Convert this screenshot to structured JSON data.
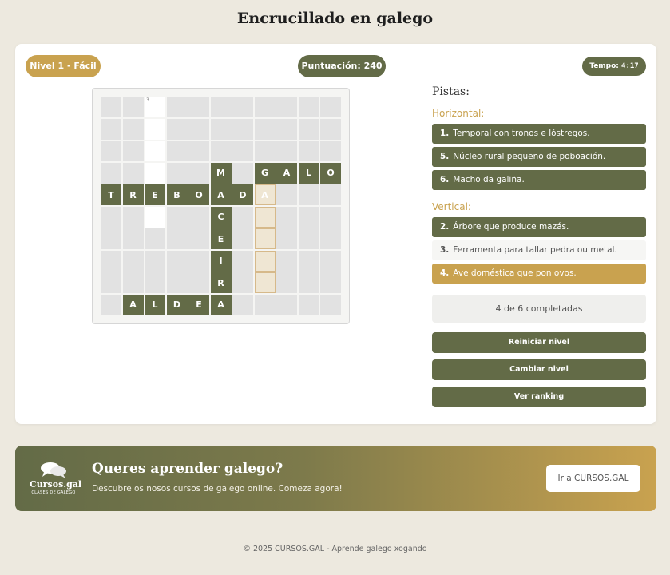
{
  "page": {
    "title": "Encrucillado en galego"
  },
  "header": {
    "level": "Nivel 1 - Fácil",
    "score": "Puntuación: 240",
    "timer_label": "Tempo:",
    "timer_value": "4:17"
  },
  "crossword": {
    "cells": [
      {
        "row": 0,
        "col": 2,
        "letter": "",
        "number": "3",
        "state": "open"
      },
      {
        "row": 1,
        "col": 2,
        "letter": "",
        "state": "open"
      },
      {
        "row": 2,
        "col": 2,
        "letter": "",
        "state": "open"
      },
      {
        "row": 3,
        "col": 2,
        "letter": "",
        "state": "open"
      },
      {
        "row": 5,
        "col": 2,
        "letter": "",
        "state": "open"
      },
      {
        "row": 3,
        "col": 5,
        "letter": "M",
        "state": "filled"
      },
      {
        "row": 3,
        "col": 7,
        "letter": "G",
        "state": "filled"
      },
      {
        "row": 3,
        "col": 8,
        "letter": "A",
        "state": "filled"
      },
      {
        "row": 3,
        "col": 9,
        "letter": "L",
        "state": "filled"
      },
      {
        "row": 3,
        "col": 10,
        "letter": "O",
        "state": "filled"
      },
      {
        "row": 4,
        "col": 0,
        "letter": "T",
        "state": "filled"
      },
      {
        "row": 4,
        "col": 1,
        "letter": "R",
        "state": "filled"
      },
      {
        "row": 4,
        "col": 2,
        "letter": "E",
        "state": "filled"
      },
      {
        "row": 4,
        "col": 3,
        "letter": "B",
        "state": "filled"
      },
      {
        "row": 4,
        "col": 4,
        "letter": "O",
        "state": "filled"
      },
      {
        "row": 4,
        "col": 5,
        "letter": "A",
        "state": "filled"
      },
      {
        "row": 4,
        "col": 6,
        "letter": "D",
        "state": "filled"
      },
      {
        "row": 4,
        "col": 7,
        "letter": "A",
        "state": "highlight"
      },
      {
        "row": 5,
        "col": 5,
        "letter": "C",
        "state": "filled"
      },
      {
        "row": 5,
        "col": 7,
        "letter": "",
        "state": "highlight"
      },
      {
        "row": 6,
        "col": 5,
        "letter": "E",
        "state": "filled"
      },
      {
        "row": 6,
        "col": 7,
        "letter": "",
        "state": "highlight"
      },
      {
        "row": 7,
        "col": 5,
        "letter": "I",
        "state": "filled"
      },
      {
        "row": 7,
        "col": 7,
        "letter": "",
        "state": "highlight"
      },
      {
        "row": 8,
        "col": 5,
        "letter": "R",
        "state": "filled"
      },
      {
        "row": 8,
        "col": 7,
        "letter": "",
        "state": "highlight"
      },
      {
        "row": 9,
        "col": 1,
        "letter": "A",
        "state": "filled"
      },
      {
        "row": 9,
        "col": 2,
        "letter": "L",
        "state": "filled"
      },
      {
        "row": 9,
        "col": 3,
        "letter": "D",
        "state": "filled"
      },
      {
        "row": 9,
        "col": 4,
        "letter": "E",
        "state": "filled"
      },
      {
        "row": 9,
        "col": 5,
        "letter": "A",
        "state": "filled"
      }
    ]
  },
  "clues": {
    "title": "Pistas:",
    "horizontal_title": "Horizontal:",
    "horizontal": [
      {
        "num": "1.",
        "text": "Temporal con tronos e lóstregos.",
        "state": "done"
      },
      {
        "num": "5.",
        "text": "Núcleo rural pequeno de poboación.",
        "state": "done"
      },
      {
        "num": "6.",
        "text": "Macho da galiña.",
        "state": "done"
      }
    ],
    "vertical_title": "Vertical:",
    "vertical": [
      {
        "num": "2.",
        "text": "Árbore que produce mazás.",
        "state": "done"
      },
      {
        "num": "3.",
        "text": "Ferramenta para tallar pedra ou metal.",
        "state": "pending"
      },
      {
        "num": "4.",
        "text": "Ave doméstica que pon ovos.",
        "state": "active"
      }
    ]
  },
  "progress": "4 de 6 completadas",
  "buttons": {
    "reset": "Reiniciar nivel",
    "change": "Cambiar nivel",
    "ranking": "Ver ranking"
  },
  "promo": {
    "logo_text": "Cursos.gal",
    "logo_sub": "CLASES DE GALEGO",
    "title": "Queres aprender galego?",
    "subtitle": "Descubre os nosos cursos de galego online. Comeza agora!",
    "button": "Ir a CURSOS.GAL"
  },
  "footer": "© 2025 CURSOS.GAL - Aprende galego xogando",
  "colors": {
    "accent": "#636b47",
    "gold": "#c9a24f",
    "background": "#ede9df"
  }
}
